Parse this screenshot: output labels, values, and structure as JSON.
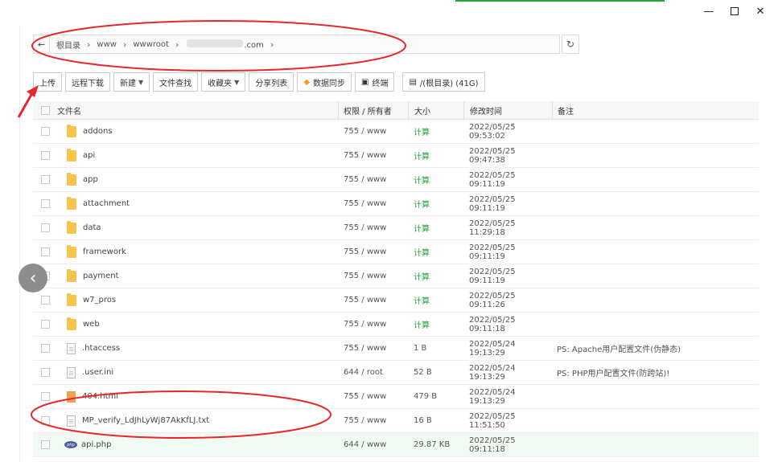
{
  "path": {
    "back_glyph": "←",
    "crumbs": [
      "根目录",
      "www",
      "wwwroot"
    ],
    "domain_suffix": ".com"
  },
  "toolbar": {
    "upload": "上传",
    "remote_download": "远程下载",
    "new": "新建",
    "file_search": "文件查找",
    "favorites": "收藏夹",
    "share_list": "分享列表",
    "data_sync": "数据同步",
    "terminal": "终端",
    "disk": "/(根目录) (41G)"
  },
  "table": {
    "headers": {
      "name": "文件名",
      "perm": "权限 / 所有者",
      "size": "大小",
      "mtime": "修改时间",
      "note": "备注"
    },
    "rows": [
      {
        "type": "folder",
        "name": "addons",
        "perm": "755 / www",
        "size": "计算",
        "mtime": "2022/05/25 09:53:02",
        "note": ""
      },
      {
        "type": "folder",
        "name": "api",
        "perm": "755 / www",
        "size": "计算",
        "mtime": "2022/05/25 09:47:38",
        "note": ""
      },
      {
        "type": "folder",
        "name": "app",
        "perm": "755 / www",
        "size": "计算",
        "mtime": "2022/05/25 09:11:19",
        "note": ""
      },
      {
        "type": "folder",
        "name": "attachment",
        "perm": "755 / www",
        "size": "计算",
        "mtime": "2022/05/25 09:11:19",
        "note": ""
      },
      {
        "type": "folder",
        "name": "data",
        "perm": "755 / www",
        "size": "计算",
        "mtime": "2022/05/25 11:29:18",
        "note": ""
      },
      {
        "type": "folder",
        "name": "framework",
        "perm": "755 / www",
        "size": "计算",
        "mtime": "2022/05/25 09:11:19",
        "note": ""
      },
      {
        "type": "folder",
        "name": "payment",
        "perm": "755 / www",
        "size": "计算",
        "mtime": "2022/05/25 09:11:19",
        "note": ""
      },
      {
        "type": "folder",
        "name": "w7_pros",
        "perm": "755 / www",
        "size": "计算",
        "mtime": "2022/05/25 09:11:26",
        "note": ""
      },
      {
        "type": "folder",
        "name": "web",
        "perm": "755 / www",
        "size": "计算",
        "mtime": "2022/05/25 09:11:18",
        "note": ""
      },
      {
        "type": "file",
        "name": ".htaccess",
        "perm": "755 / www",
        "size": "1 B",
        "mtime": "2022/05/24 19:13:29",
        "note": "PS: Apache用户配置文件(伪静态)"
      },
      {
        "type": "file",
        "name": ".user.ini",
        "perm": "644 / root",
        "size": "52 B",
        "mtime": "2022/05/24 19:13:29",
        "note": "PS: PHP用户配置文件(防跨站)!"
      },
      {
        "type": "html",
        "name": "404.html",
        "perm": "755 / www",
        "size": "479 B",
        "mtime": "2022/05/24 19:13:29",
        "note": ""
      },
      {
        "type": "file",
        "name": "MP_verify_LdJhLyWj87AkKfLJ.txt",
        "perm": "755 / www",
        "size": "16 B",
        "mtime": "2022/05/25 11:51:50",
        "note": ""
      },
      {
        "type": "php",
        "name": "api.php",
        "perm": "644 / www",
        "size": "29.87 KB",
        "mtime": "2022/05/25 09:11:18",
        "note": ""
      }
    ]
  },
  "colors": {
    "accent": "#20a53a",
    "annotation": "#e8262b"
  },
  "icons": {
    "php_label": "php"
  }
}
